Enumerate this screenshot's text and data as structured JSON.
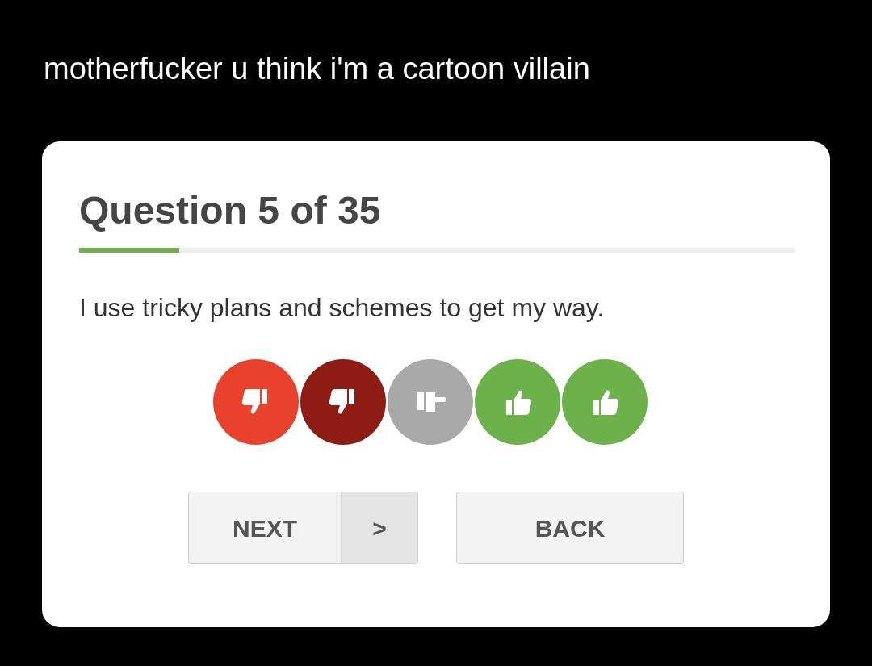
{
  "caption": "motherfucker u think i'm a cartoon villain",
  "quiz": {
    "title": "Question 5 of 35",
    "progress": {
      "level": 0.14
    },
    "question": "I use tricky plans and schemes to get my way.",
    "answers": [
      {
        "kind": "down",
        "color": "#e8412c"
      },
      {
        "kind": "down",
        "color": "#8c1c14"
      },
      {
        "kind": "neutral",
        "color": "#a9a9a9"
      },
      {
        "kind": "up",
        "color": "#6cb14a"
      },
      {
        "kind": "up",
        "color": "#6cb14a"
      }
    ],
    "next_button": {
      "label": "NEXT",
      "chevron": ">"
    },
    "back_button": {
      "label": "BACK"
    }
  }
}
